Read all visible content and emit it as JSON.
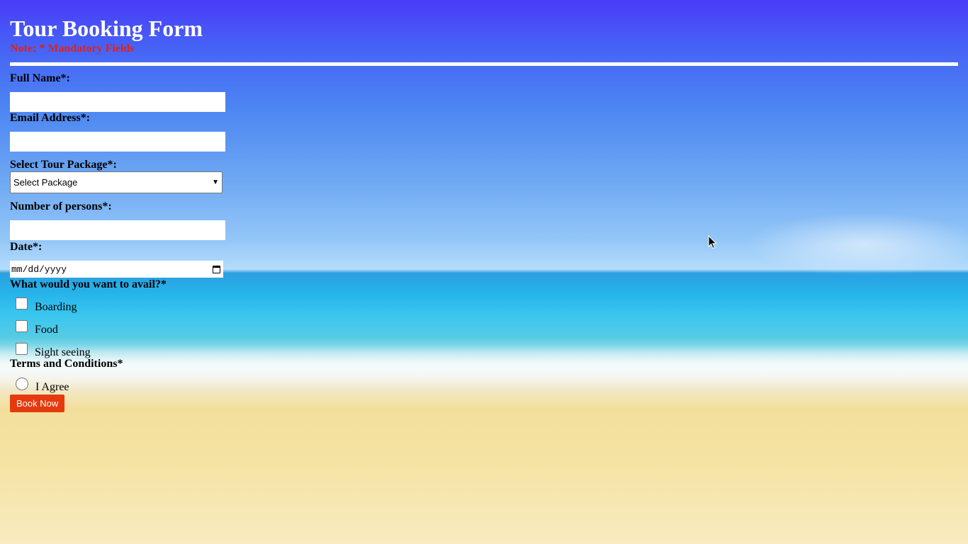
{
  "form": {
    "title": "Tour Booking Form",
    "note": "Note: * Mandatory Fields",
    "full_name_label": "Full Name*:",
    "full_name_value": "",
    "email_label": "Email Address*:",
    "email_value": "",
    "package_label": "Select Tour Package*:",
    "package_selected": "Select Package",
    "persons_label": "Number of persons*:",
    "persons_value": "",
    "date_label": "Date*:",
    "date_placeholder": "mm/dd/yyyy",
    "avail_label": "What would you want to avail?*",
    "avail_options": [
      "Boarding",
      "Food",
      "Sight seeing"
    ],
    "terms_label": "Terms and Conditions*",
    "agree_label": "I Agree",
    "submit_label": "Book Now"
  },
  "colors": {
    "note": "#e0201c",
    "button": "#e53a0e"
  },
  "icons": {
    "date": "calendar-icon",
    "select": "chevron-down-icon",
    "pointer": "mouse-cursor-icon"
  }
}
